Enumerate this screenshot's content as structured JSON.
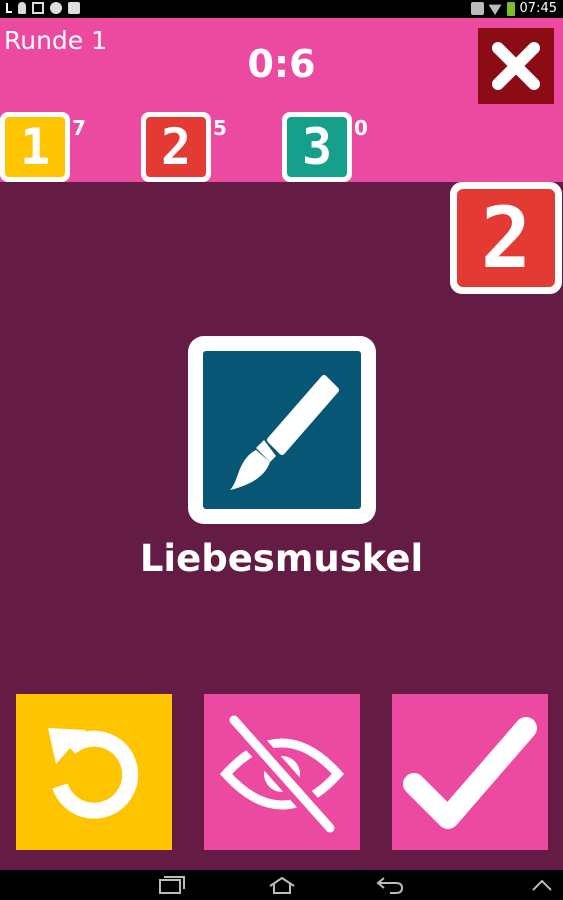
{
  "status_bar": {
    "time": "07:45",
    "left_icons": [
      "usb-icon",
      "person-icon",
      "image-icon",
      "globe-icon",
      "bag-icon"
    ],
    "right_icons": [
      "mute-icon",
      "wifi-icon",
      "battery-icon"
    ]
  },
  "header": {
    "round_label": "Runde 1",
    "timer": "0:6",
    "close_icon": "close-icon",
    "teams": [
      {
        "number": "1",
        "score": "7",
        "color": "#ffc400"
      },
      {
        "number": "2",
        "score": "5",
        "color": "#e43a34"
      },
      {
        "number": "3",
        "score": "0",
        "color": "#16a08c"
      }
    ]
  },
  "main": {
    "active_team": {
      "number": "2",
      "color": "#e43a34"
    },
    "category_icon": "brush-icon",
    "category_color": "#075676",
    "term": "Liebesmuskel"
  },
  "actions": [
    {
      "name": "undo-button",
      "icon": "undo-icon",
      "color": "#ffc400"
    },
    {
      "name": "hide-button",
      "icon": "eye-off-icon",
      "color": "#ec49a0"
    },
    {
      "name": "correct-button",
      "icon": "checkmark-icon",
      "color": "#ec49a0"
    }
  ],
  "colors": {
    "header_bg": "#ec49a0",
    "main_bg": "#641c45",
    "close_bg": "#8b0c14"
  },
  "nav_bar": {
    "icons": [
      "recent-apps-icon",
      "home-icon",
      "back-icon",
      "chevron-up-icon"
    ]
  }
}
